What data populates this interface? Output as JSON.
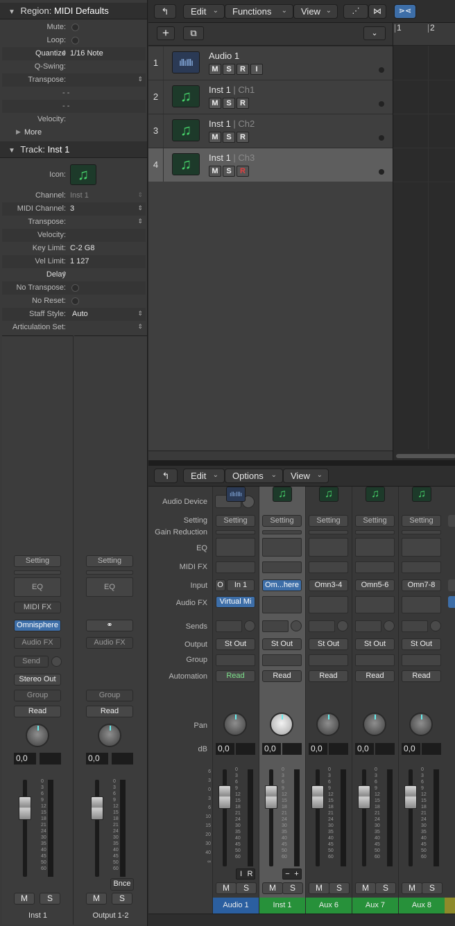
{
  "inspector": {
    "region": {
      "header_label": "Region:",
      "header_value": "MIDI Defaults",
      "rows": [
        {
          "label": "Mute:",
          "value": ""
        },
        {
          "label": "Loop:",
          "value": ""
        },
        {
          "label": "Quantize",
          "value": "1/16 Note"
        },
        {
          "label": "Q-Swing:",
          "value": ""
        },
        {
          "label": "Transpose:",
          "value": ""
        },
        {
          "label": "",
          "value": "- -"
        },
        {
          "label": "",
          "value": "- -"
        },
        {
          "label": "Velocity:",
          "value": ""
        }
      ],
      "more_label": "More"
    },
    "track": {
      "header_label": "Track:",
      "header_value": "Inst 1",
      "icon_label": "Icon:",
      "rows": [
        {
          "label": "Channel:",
          "value": "Inst 1"
        },
        {
          "label": "MIDI Channel:",
          "value": "3"
        },
        {
          "label": "Transpose:",
          "value": ""
        },
        {
          "label": "Velocity:",
          "value": ""
        },
        {
          "label": "Key Limit:",
          "value": "C-2  G8"
        },
        {
          "label": "Vel Limit:",
          "value": "1  127"
        },
        {
          "label": "Delay",
          "value": ""
        },
        {
          "label": "No Transpose:",
          "value": ""
        },
        {
          "label": "No Reset:",
          "value": ""
        },
        {
          "label": "Staff Style:",
          "value": "Auto"
        },
        {
          "label": "Articulation Set:",
          "value": ""
        }
      ]
    },
    "strips": [
      {
        "setting": "Setting",
        "eq": "EQ",
        "midi_fx": "MIDI FX",
        "instrument": "Omnisphere",
        "audio_fx": "Audio FX",
        "send": "Send",
        "output": "Stereo Out",
        "group": "Group",
        "automation": "Read",
        "db": "0,0",
        "mute": "M",
        "solo": "S",
        "name": "Inst 1"
      },
      {
        "setting": "Setting",
        "eq": "EQ",
        "link_icon": "link-icon",
        "audio_fx": "Audio FX",
        "group": "Group",
        "automation": "Read",
        "db": "0,0",
        "bounce": "Bnce",
        "mute": "M",
        "solo": "S",
        "name": "Output 1-2"
      }
    ]
  },
  "tracks_toolbar": {
    "back_icon": "back-arrow-icon",
    "edit": "Edit",
    "functions": "Functions",
    "view": "View",
    "ruler": [
      "1",
      "2"
    ]
  },
  "tracks": [
    {
      "number": "1",
      "name": "Audio 1",
      "sub": "",
      "type": "audio",
      "buttons": [
        "M",
        "S",
        "R",
        "I"
      ]
    },
    {
      "number": "2",
      "name": "Inst 1",
      "sub": "Ch1",
      "type": "midi",
      "buttons": [
        "M",
        "S",
        "R"
      ]
    },
    {
      "number": "3",
      "name": "Inst 1",
      "sub": "Ch2",
      "type": "midi",
      "buttons": [
        "M",
        "S",
        "R"
      ]
    },
    {
      "number": "4",
      "name": "Inst 1",
      "sub": "Ch3",
      "type": "midi",
      "buttons": [
        "M",
        "S",
        "R"
      ],
      "selected": true
    }
  ],
  "mixer_toolbar": {
    "edit": "Edit",
    "options": "Options",
    "view": "View"
  },
  "mixer_labels": {
    "audio_device": "Audio Device",
    "setting": "Setting",
    "gain_reduction": "Gain Reduction",
    "eq": "EQ",
    "midi_fx": "MIDI FX",
    "input": "Input",
    "audio_fx": "Audio FX",
    "sends": "Sends",
    "output": "Output",
    "group": "Group",
    "automation": "Automation",
    "pan": "Pan",
    "db": "dB"
  },
  "mixer_strips": [
    {
      "setting": "Setting",
      "input": "In 1",
      "input_prefix": "O",
      "audio_fx": "Virtual Mi",
      "output": "St Out",
      "automation": "Read",
      "db": "0,0",
      "extra": [
        "I",
        "R"
      ],
      "mute": "M",
      "solo": "S",
      "name": "Audio 1",
      "color": "#2b5fa0",
      "type": "audio"
    },
    {
      "setting": "Setting",
      "input": "Om...here",
      "output": "St Out",
      "automation": "Read",
      "db": "0,0",
      "extra": [
        "−",
        "+"
      ],
      "mute": "M",
      "solo": "S",
      "name": "Inst 1",
      "color": "#27913a",
      "type": "midi",
      "selected": true
    },
    {
      "setting": "Setting",
      "input": "Omn3-4",
      "output": "St Out",
      "automation": "Read",
      "db": "0,0",
      "mute": "M",
      "solo": "S",
      "name": "Aux 6",
      "color": "#27913a",
      "type": "midi"
    },
    {
      "setting": "Setting",
      "input": "Omn5-6",
      "output": "St Out",
      "automation": "Read",
      "db": "0,0",
      "mute": "M",
      "solo": "S",
      "name": "Aux 7",
      "color": "#27913a",
      "type": "midi"
    },
    {
      "setting": "Setting",
      "input": "Omn7-8",
      "output": "St Out",
      "automation": "Read",
      "db": "0,0",
      "mute": "M",
      "solo": "S",
      "name": "Aux 8",
      "color": "#27913a",
      "type": "midi"
    }
  ],
  "fader_scale": [
    "0",
    "3",
    "6",
    "9",
    "12",
    "15",
    "18",
    "21",
    "24",
    "30",
    "35",
    "40",
    "45",
    "50",
    "60"
  ],
  "mixer_left_scale": [
    "6",
    "3",
    "0",
    "3",
    "6",
    "10",
    "15",
    "20",
    "30",
    "40",
    "∞"
  ],
  "colors": {
    "accent_blue": "#3d6ea8",
    "midi_green": "#46d36a",
    "record_red": "#d23a3a"
  }
}
